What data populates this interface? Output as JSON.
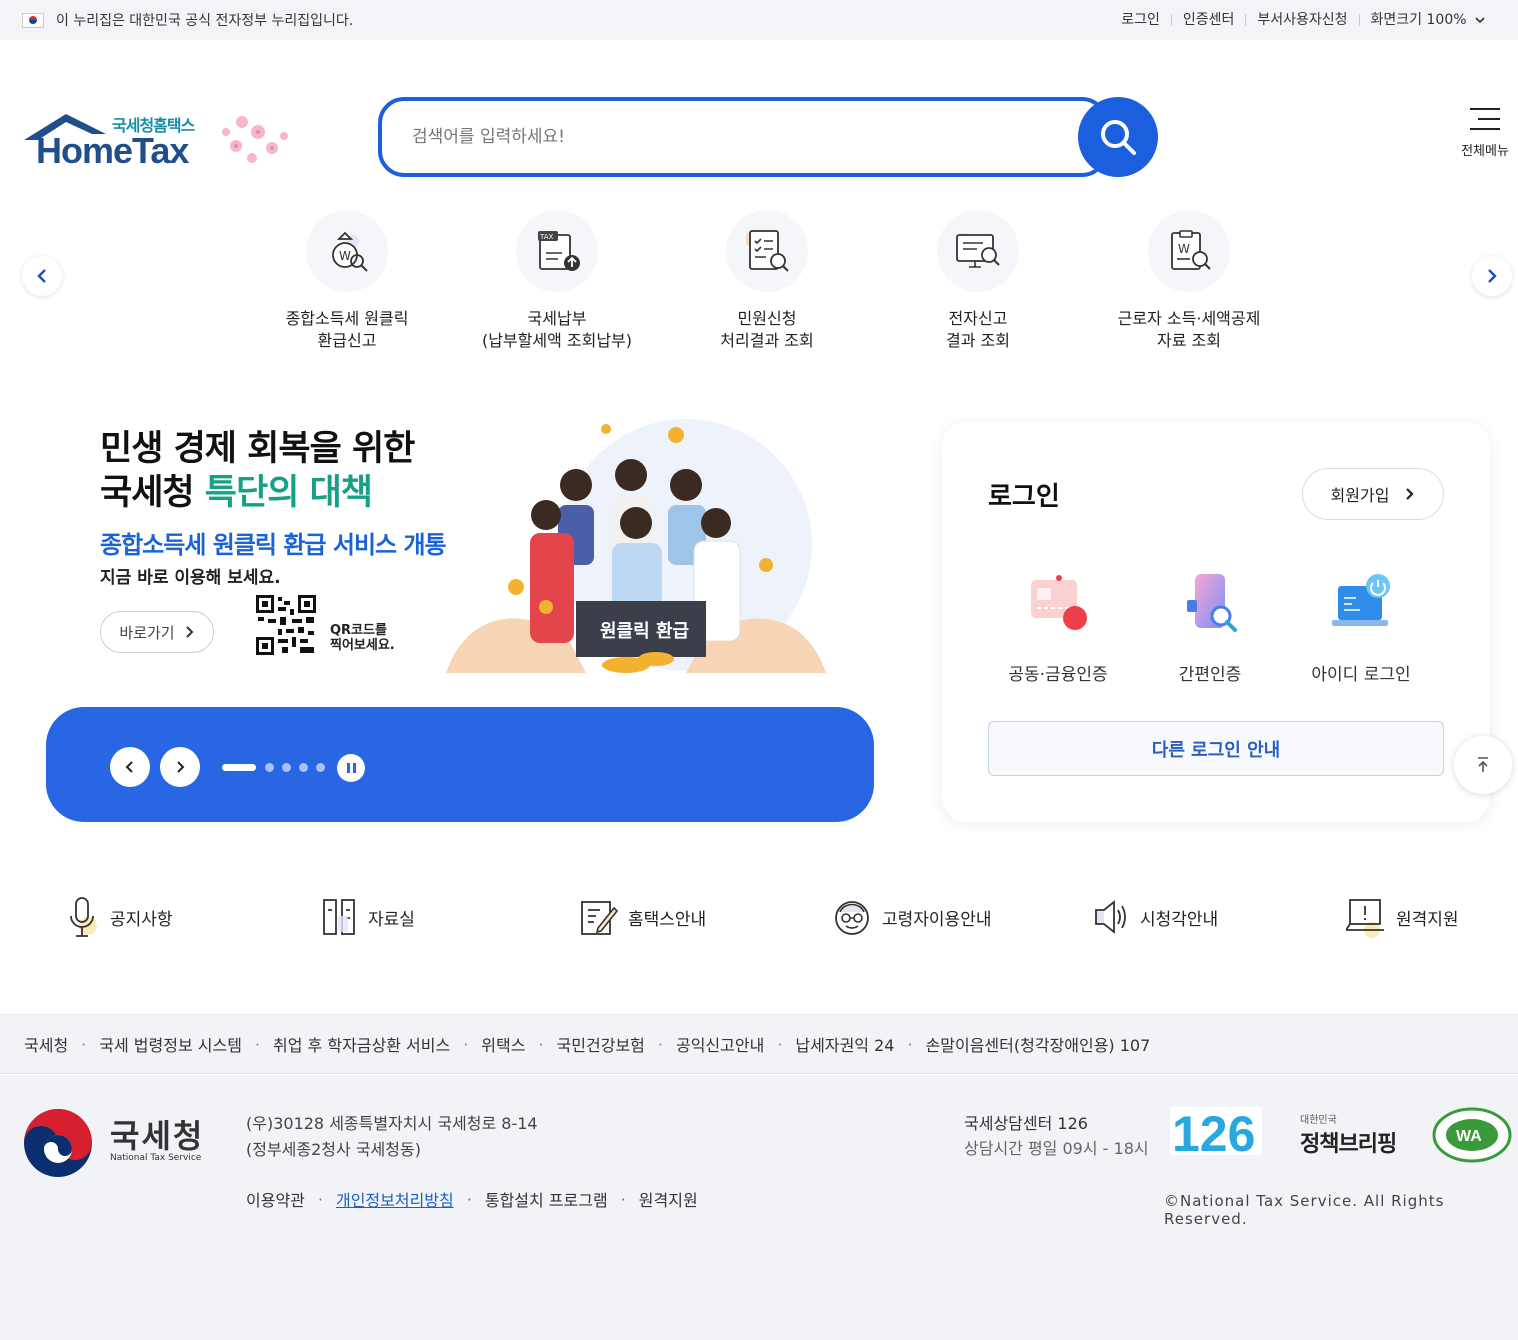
{
  "topbar": {
    "gov_notice": "이 누리집은 대한민국 공식 전자정부 누리집입니다.",
    "links": [
      "로그인",
      "인증센터",
      "부서사용자신청",
      "화면크기 100%"
    ]
  },
  "logo": {
    "sub": "국세청홈택스",
    "main": "HomeTax"
  },
  "search": {
    "placeholder": "검색어를 입력하세요!"
  },
  "allmenu": {
    "label": "전체메뉴"
  },
  "quick_menu": [
    {
      "label": "종합소득세 원클릭\n환급신고",
      "icon": "money-bag-search-icon"
    },
    {
      "label": "국세납부\n(납부할세액 조회납부)",
      "icon": "tax-document-upload-icon"
    },
    {
      "label": "민원신청\n처리결과 조회",
      "icon": "checklist-search-icon"
    },
    {
      "label": "전자신고\n결과 조회",
      "icon": "monitor-search-icon"
    },
    {
      "label": "근로자 소득·세액공제\n자료 조회",
      "icon": "won-document-search-icon"
    }
  ],
  "banner": {
    "line1": "민생 경제 회복을 위한",
    "line2a": "국세청 ",
    "line2b": "특단의 대책",
    "subtitle": "종합소득세 원클릭 환급 서비스 개통",
    "desc": "지금 바로 이용해 보세요.",
    "go": "바로가기",
    "qr_text": "QR코드를\n찍어보세요.",
    "sign": "원클릭 환급"
  },
  "slider": {
    "total": 5,
    "active": 1
  },
  "login": {
    "title": "로그인",
    "join": "회원가입",
    "options": [
      "공동·금융인증",
      "간편인증",
      "아이디 로그인"
    ],
    "other": "다른 로그인 안내"
  },
  "services": [
    {
      "label": "공지사항",
      "icon": "microphone-icon"
    },
    {
      "label": "자료실",
      "icon": "archive-icon"
    },
    {
      "label": "홈택스안내",
      "icon": "guide-edit-icon"
    },
    {
      "label": "고령자이용안내",
      "icon": "elderly-icon"
    },
    {
      "label": "시청각안내",
      "icon": "speaker-icon"
    },
    {
      "label": "원격지원",
      "icon": "remote-support-icon"
    }
  ],
  "footer_links": [
    "국세청",
    "국세 법령정보 시스템",
    "취업 후 학자금상환 서비스",
    "위택스",
    "국민건강보험",
    "공익신고안내",
    "납세자권익 24",
    "손말이음센터(청각장애인용) 107"
  ],
  "footer": {
    "org_name": "국세청",
    "org_en": "National Tax Service",
    "address1": "(우)30128 세종특별자치시 국세청로 8-14",
    "address2": "(정부세종2청사 국세청동)",
    "links": [
      "이용약관",
      "개인정보처리방침",
      "통합설치 프로그램",
      "원격지원"
    ],
    "call_center": "국세상담센터 126",
    "hours": "상담시간 평일 09시 - 18시",
    "badge_126": "126",
    "policy_small": "대한민국",
    "policy_main": "정책브리핑",
    "wa": "WA",
    "copyright": "©National Tax Service. All Rights Reserved."
  },
  "colors": {
    "primary": "#1b5fde",
    "slider_bg": "#2866e4",
    "teal": "#16a085"
  }
}
